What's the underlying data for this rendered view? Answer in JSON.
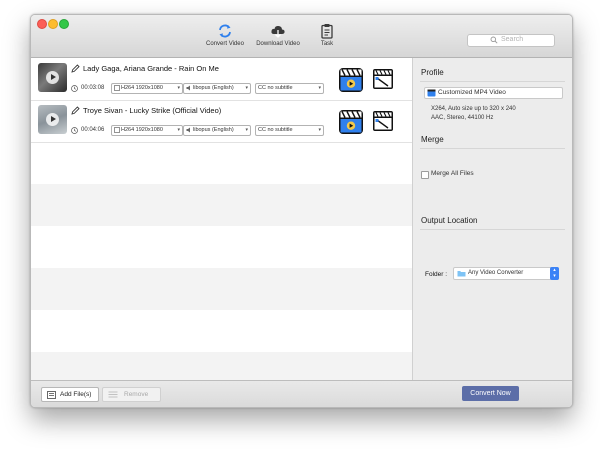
{
  "toolbar": {
    "convert_label": "Convert Video",
    "download_label": "Download Video",
    "task_label": "Task",
    "search_placeholder": "Search"
  },
  "videos": [
    {
      "title": "Lady Gaga, Ariana Grande - Rain On Me",
      "duration": "00:03:08",
      "video_codec": "H264 1920x1080",
      "audio_track": "libopus (English)",
      "subtitle": "CC no subtitle"
    },
    {
      "title": "Troye Sivan - Lucky Strike (Official Video)",
      "duration": "00:04:06",
      "video_codec": "H264 1920x1080",
      "audio_track": "libopus (English)",
      "subtitle": "CC no subtitle"
    }
  ],
  "panel": {
    "profile_title": "Profile",
    "profile_value": "Customized MP4 Video",
    "profile_desc_line1": "X264, Auto size up to 320 x 240",
    "profile_desc_line2": "AAC, Stereo, 44100 Hz",
    "merge_title": "Merge",
    "merge_checkbox_label": "Merge All Files",
    "merge_checked": false,
    "output_title": "Output Location",
    "folder_label": "Folder :",
    "folder_value": "Any Video Converter"
  },
  "footer": {
    "add_label": "Add File(s)",
    "remove_label": "Remove",
    "convert_now_label": "Convert Now"
  },
  "colors": {
    "accent_blue": "#3b82f6",
    "convert_button": "#5c6ea8",
    "traffic_close": "#fc5f57",
    "traffic_minimize": "#fdbc2e",
    "traffic_maximize": "#33c748"
  }
}
